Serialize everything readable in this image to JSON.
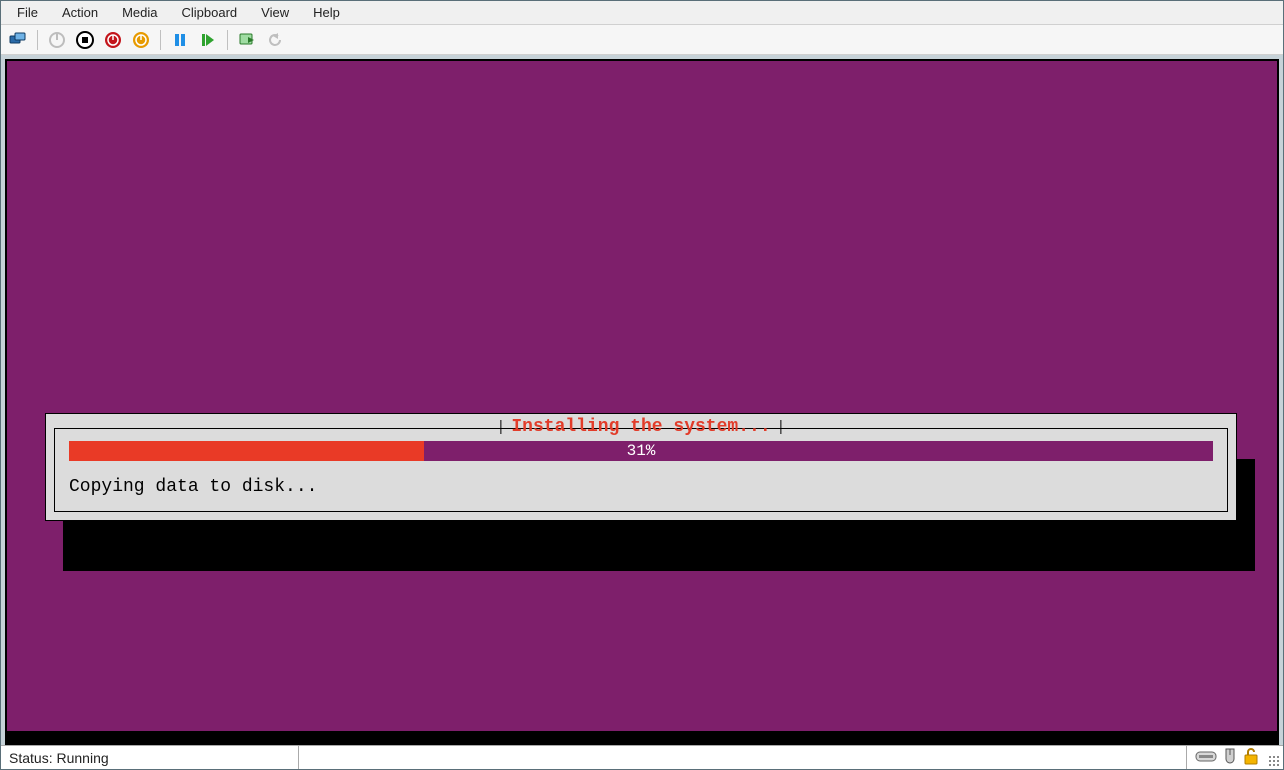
{
  "menu": {
    "items": [
      "File",
      "Action",
      "Media",
      "Clipboard",
      "View",
      "Help"
    ]
  },
  "toolbar": {
    "icons": {
      "connect": "connect-icon",
      "ctrlaltdel_disabled": "power-grey-icon",
      "turnoff": "stop-icon",
      "shutdown": "shutdown-icon",
      "save": "save-state-icon",
      "pause": "pause-icon",
      "start": "start-icon",
      "checkpoint": "checkpoint-icon",
      "revert": "revert-icon"
    }
  },
  "installer": {
    "title": "Installing the system...",
    "progress_percent": 31,
    "progress_label": "31%",
    "message": "Copying data to disk..."
  },
  "status": {
    "label": "Status:",
    "value": "Running"
  },
  "colors": {
    "vm_bg": "#7e1f6b",
    "progress_fill": "#e93a26",
    "title_text": "#e23c2a"
  }
}
